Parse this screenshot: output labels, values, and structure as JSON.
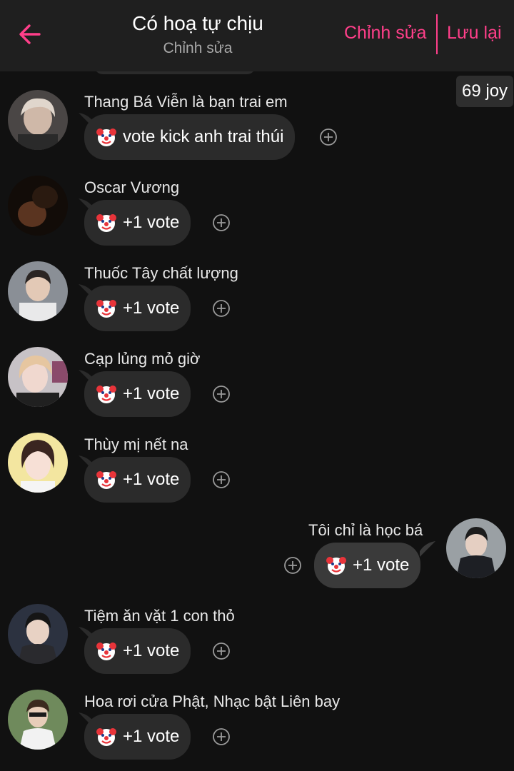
{
  "header": {
    "title": "Có hoạ tự chịu",
    "subtitle": "Chỉnh sửa",
    "edit_label": "Chỉnh sửa",
    "save_label": "Lưu lại",
    "accent_color": "#ff3f8a"
  },
  "joy_badge": "69 joy",
  "reaction_emoji": "clown-face",
  "messages": [
    {
      "sender": "Thang Bá Viễn là bạn trai em",
      "text": "vote kick anh trai thúi",
      "mine": false
    },
    {
      "sender": "Oscar Vương",
      "text": "+1 vote",
      "mine": false
    },
    {
      "sender": "Thuốc Tây chất lượng",
      "text": "+1 vote",
      "mine": false
    },
    {
      "sender": "Cạp lủng mỏ giờ",
      "text": "+1 vote",
      "mine": false
    },
    {
      "sender": "Thùy mị nết na",
      "text": "+1 vote",
      "mine": false
    },
    {
      "sender": "Tôi chỉ là học bá",
      "text": "+1 vote",
      "mine": true
    },
    {
      "sender": "Tiệm ăn vặt 1 con thỏ",
      "text": "+1 vote",
      "mine": false
    },
    {
      "sender": "Hoa rơi cửa Phật, Nhạc bật Liên bay",
      "text": "+1 vote",
      "mine": false
    }
  ]
}
